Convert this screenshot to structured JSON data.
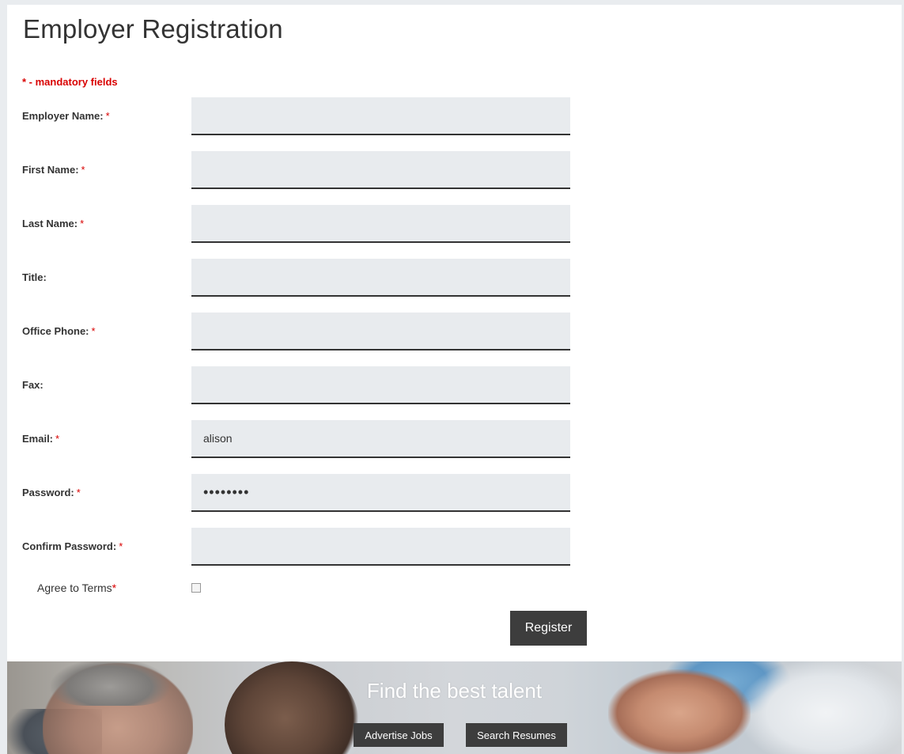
{
  "page": {
    "title": "Employer Registration",
    "mandatory_note": "* - mandatory fields"
  },
  "form": {
    "required_marker": "*",
    "fields": [
      {
        "label": "Employer Name:",
        "required": true,
        "value": ""
      },
      {
        "label": "First Name:",
        "required": true,
        "value": ""
      },
      {
        "label": "Last Name:",
        "required": true,
        "value": ""
      },
      {
        "label": "Title:",
        "required": false,
        "value": ""
      },
      {
        "label": "Office Phone:",
        "required": true,
        "value": ""
      },
      {
        "label": "Fax:",
        "required": false,
        "value": ""
      },
      {
        "label": "Email:",
        "required": true,
        "value": "alison"
      },
      {
        "label": "Password:",
        "required": true,
        "value": "••••••••"
      },
      {
        "label": "Confirm Password:",
        "required": true,
        "value": ""
      }
    ],
    "terms_label": "Agree to Terms",
    "terms_checked": false,
    "register_label": "Register"
  },
  "banner": {
    "headline": "Find the best talent",
    "advertise_label": "Advertise Jobs",
    "search_label": "Search Resumes"
  },
  "colors": {
    "required": "#d90000",
    "button_bg": "#3d3d3d",
    "field_bg": "#e8ebee"
  }
}
